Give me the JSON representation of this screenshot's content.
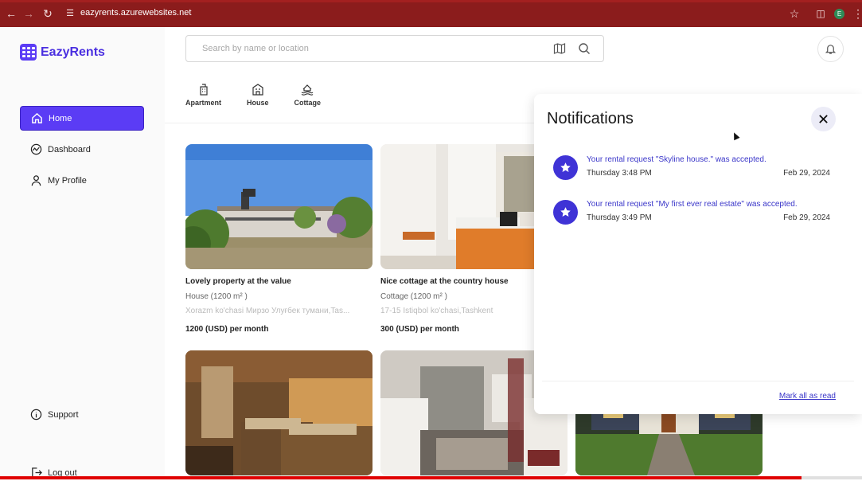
{
  "browser": {
    "url": "eazyrents.azurewebsites.net",
    "avatar_letter": "E",
    "progress_fraction": 0.93
  },
  "brand": {
    "name": "EazyRents",
    "color": "#5b3cf5"
  },
  "sidebar": {
    "items": [
      {
        "label": "Home",
        "icon": "home-icon",
        "active": true
      },
      {
        "label": "Dashboard",
        "icon": "trend-icon",
        "active": false
      },
      {
        "label": "My Profile",
        "icon": "user-icon",
        "active": false
      }
    ],
    "bottom": [
      {
        "label": "Support",
        "icon": "info-icon"
      },
      {
        "label": "Log out",
        "icon": "logout-icon"
      }
    ]
  },
  "search": {
    "placeholder": "Search by name or location"
  },
  "categories": [
    {
      "label": "Apartment",
      "icon": "apartment-icon"
    },
    {
      "label": "House",
      "icon": "house-icon"
    },
    {
      "label": "Cottage",
      "icon": "cottage-icon"
    }
  ],
  "listings": [
    {
      "title": "Lovely property at the value",
      "type": "House (1200 m² )",
      "address": "Xorazm ko'chasi Мирзо Улуғбек тумани,Tas...",
      "price": "1200 (USD) per month"
    },
    {
      "title": "Nice cottage at the country house",
      "type": "Cottage (1200 m² )",
      "address": "17-15 Istiqbol ko'chasi,Tashkent",
      "price": "300 (USD) per month"
    }
  ],
  "notifications": {
    "title": "Notifications",
    "items": [
      {
        "message": "Your rental request \"Skyline house.\" was accepted.",
        "time": "Thursday 3:48 PM",
        "date": "Feb 29, 2024"
      },
      {
        "message": "Your rental request \"My first ever real estate\" was accepted.",
        "time": "Thursday 3:49 PM",
        "date": "Feb 29, 2024"
      }
    ],
    "mark_all_label": "Mark all as read"
  }
}
